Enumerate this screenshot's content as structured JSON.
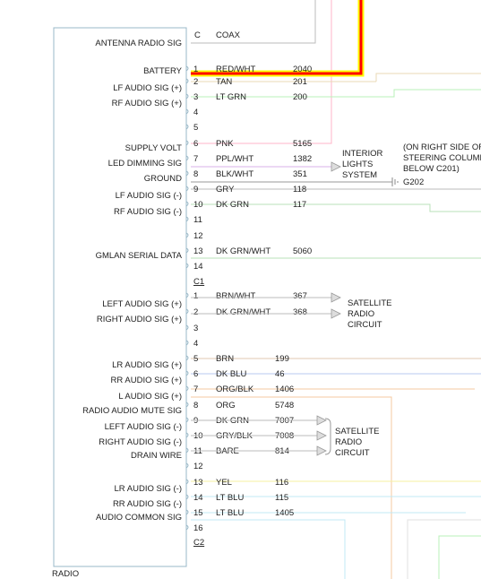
{
  "module": {
    "name": "RADIO"
  },
  "top_pin": {
    "connector": "C",
    "circuit": "COAX",
    "label": "ANTENNA RADIO SIG"
  },
  "connectors": [
    "C1",
    "C2"
  ],
  "pins": [
    {
      "label": "BATTERY",
      "pin": "1",
      "wire": "RED/WHT",
      "circuit": "2040",
      "color": "#ff0000"
    },
    {
      "label": "",
      "pin": "2",
      "wire": "TAN",
      "circuit": "201",
      "color": "#e8d9b5"
    },
    {
      "label": "LF AUDIO SIG (+)",
      "pin": "",
      "wire": "",
      "circuit": "",
      "color": ""
    },
    {
      "label": "RF AUDIO SIG (+)",
      "pin": "3",
      "wire": "LT GRN",
      "circuit": "200",
      "color": "#b8f0b8"
    },
    {
      "label": "",
      "pin": "4",
      "wire": "",
      "circuit": "",
      "color": ""
    },
    {
      "label": "",
      "pin": "5",
      "wire": "",
      "circuit": "",
      "color": ""
    },
    {
      "label": "SUPPLY VOLT",
      "pin": "6",
      "wire": "PNK",
      "circuit": "5165",
      "color": "#ffb6c8"
    },
    {
      "label": "LED DIMMING SIG",
      "pin": "7",
      "wire": "PPL/WHT",
      "circuit": "1382",
      "color": "#d8b0e8"
    },
    {
      "label": "GROUND",
      "pin": "8",
      "wire": "BLK/WHT",
      "circuit": "351",
      "color": "#999999"
    },
    {
      "label": "",
      "pin": "9",
      "wire": "GRY",
      "circuit": "118",
      "color": "#bbbbbb"
    },
    {
      "label": "LF AUDIO SIG (-)",
      "pin": "10",
      "wire": "DK GRN",
      "circuit": "117",
      "color": "#b8e0b8"
    },
    {
      "label": "RF AUDIO SIG (-)",
      "pin": "11",
      "wire": "",
      "circuit": "",
      "color": ""
    },
    {
      "label": "",
      "pin": "12",
      "wire": "",
      "circuit": "",
      "color": ""
    },
    {
      "label": "GMLAN SERIAL DATA",
      "pin": "13",
      "wire": "DK GRN/WHT",
      "circuit": "5060",
      "color": "#b8e0b8"
    },
    {
      "label": "",
      "pin": "14",
      "wire": "",
      "circuit": "",
      "color": ""
    },
    {
      "label": "LEFT AUDIO SIG (+)",
      "pin": "1",
      "wire": "BRN/WHT",
      "circuit": "367",
      "color": "#d9c0a8"
    },
    {
      "label": "RIGHT AUDIO SIG (+)",
      "pin": "2",
      "wire": "DK GRN/WHT",
      "circuit": "368",
      "color": "#b8e0b8"
    },
    {
      "label": "",
      "pin": "3",
      "wire": "",
      "circuit": "",
      "color": ""
    },
    {
      "label": "",
      "pin": "4",
      "wire": "",
      "circuit": "",
      "color": ""
    },
    {
      "label": "LR AUDIO SIG (+)",
      "pin": "5",
      "wire": "BRN",
      "circuit": "199",
      "color": "#e0c8b0"
    },
    {
      "label": "RR AUDIO SIG (+)",
      "pin": "6",
      "wire": "DK BLU",
      "circuit": "46",
      "color": "#b8c8f0"
    },
    {
      "label": "L AUDIO SIG (+)",
      "pin": "7",
      "wire": "ORG/BLK",
      "circuit": "1406",
      "color": "#f5c8a0"
    },
    {
      "label": "RADIO AUDIO MUTE SIG",
      "pin": "8",
      "wire": "ORG",
      "circuit": "5748",
      "color": "#f5c8a0"
    },
    {
      "label": "LEFT AUDIO SIG (-)",
      "pin": "9",
      "wire": "DK GRN",
      "circuit": "7007",
      "color": "#b8e0b8"
    },
    {
      "label": "RIGHT AUDIO SIG (-)",
      "pin": "10",
      "wire": "GRY/BLK",
      "circuit": "7008",
      "color": "#bbbbbb"
    },
    {
      "label": "DRAIN WIRE",
      "pin": "11",
      "wire": "BARE",
      "circuit": "814",
      "color": "#aaaaaa"
    },
    {
      "label": "",
      "pin": "12",
      "wire": "",
      "circuit": "",
      "color": ""
    },
    {
      "label": "LR AUDIO SIG (-)",
      "pin": "13",
      "wire": "YEL",
      "circuit": "116",
      "color": "#f5f0a0"
    },
    {
      "label": "RR AUDIO SIG (-)",
      "pin": "14",
      "wire": "LT BLU",
      "circuit": "115",
      "color": "#c0e8f5"
    },
    {
      "label": "AUDIO COMMON SIG",
      "pin": "15",
      "wire": "LT BLU",
      "circuit": "1405",
      "color": "#c0e8f5"
    },
    {
      "label": "",
      "pin": "16",
      "wire": "",
      "circuit": "",
      "color": ""
    }
  ],
  "destinations": {
    "interior_lights": [
      "INTERIOR",
      "LIGHTS",
      "SYSTEM"
    ],
    "ground_note": [
      "(ON RIGHT SIDE OF",
      "STEERING COLUMN",
      "BELOW C201)"
    ],
    "ground_ref": "G202",
    "satellite_a": [
      "SATELLITE",
      "RADIO",
      "CIRCUIT"
    ],
    "satellite_b": [
      "SATELLITE",
      "RADIO",
      "CIRCUIT"
    ]
  }
}
